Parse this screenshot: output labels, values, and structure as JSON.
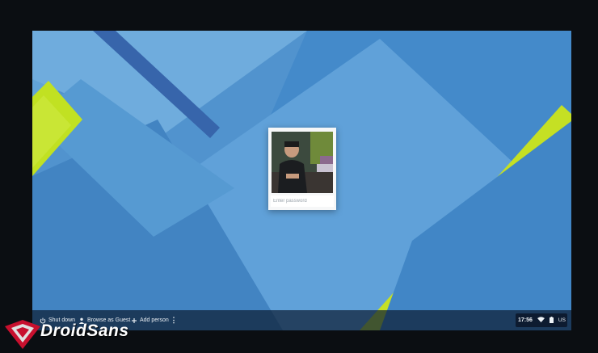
{
  "login": {
    "password_placeholder": "Enter password"
  },
  "shelf": {
    "shutdown_label": "Shut down",
    "guest_label": "Browse as Guest",
    "add_person_label": "Add person",
    "more_label": "⋮"
  },
  "status": {
    "time": "17:56",
    "keyboard_layout": "US",
    "icons": [
      "wifi-icon",
      "battery-icon"
    ]
  },
  "watermark": {
    "text": "DroidSans"
  },
  "colors": {
    "wallpaper_base": "#3f86c4",
    "accent_lime": "#c8e21e",
    "shelf": "#0e1e34"
  }
}
